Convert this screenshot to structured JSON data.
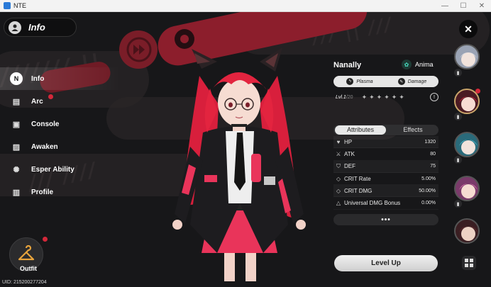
{
  "window": {
    "title": "NTE",
    "minimize": "—",
    "maximize": "☐",
    "close": "✕"
  },
  "header": {
    "title": "Info"
  },
  "nav": {
    "items": [
      {
        "label": "Info",
        "icon": "N",
        "active": true,
        "badge": false
      },
      {
        "label": "Arc",
        "icon": "▤",
        "active": false,
        "badge": true
      },
      {
        "label": "Console",
        "icon": "▣",
        "active": false,
        "badge": false
      },
      {
        "label": "Awaken",
        "icon": "▨",
        "active": false,
        "badge": false
      },
      {
        "label": "Esper Ability",
        "icon": "✺",
        "active": false,
        "badge": false
      },
      {
        "label": "Profile",
        "icon": "▥",
        "active": false,
        "badge": false
      }
    ]
  },
  "outfit": {
    "label": "Outfit",
    "badge": true
  },
  "uid": "UID: 215200277204",
  "character": {
    "name": "Nanally",
    "element": "Anima",
    "tags": [
      {
        "label": "Plasma",
        "icon": "ϟ"
      },
      {
        "label": "Damage",
        "icon": "✎"
      }
    ],
    "level_label": "Lvl.",
    "level_current": "1",
    "level_max": "20",
    "stars": [
      "✦",
      "✦",
      "✦",
      "✦",
      "✦",
      "✦"
    ]
  },
  "tabs": [
    {
      "label": "Attributes",
      "active": true
    },
    {
      "label": "Effects",
      "active": false
    }
  ],
  "stats": [
    {
      "icon": "♥",
      "label": "HP",
      "value": "1320"
    },
    {
      "icon": "⚔",
      "label": "ATK",
      "value": "80"
    },
    {
      "icon": "⛉",
      "label": "DEF",
      "value": "75"
    },
    {
      "icon": "◇",
      "label": "CRIT Rate",
      "value": "5.00%"
    },
    {
      "icon": "◇",
      "label": "CRIT DMG",
      "value": "50.00%"
    },
    {
      "icon": "△",
      "label": "Universal DMG Bonus",
      "value": "0.00%"
    }
  ],
  "more_label": "•••",
  "level_up_label": "Level Up",
  "colors": {
    "accent_red": "#d4283a",
    "bg": "#171719",
    "hair": "#e3243f"
  }
}
